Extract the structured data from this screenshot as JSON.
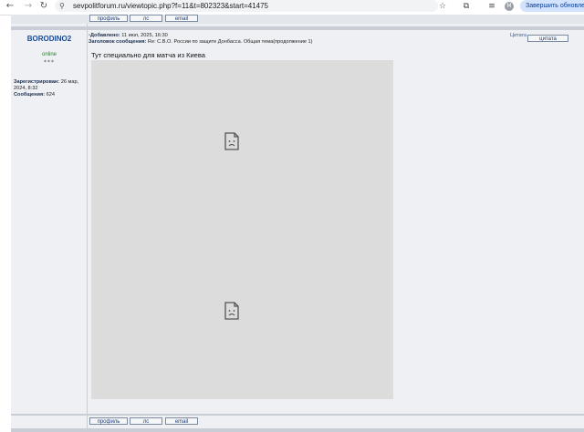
{
  "browser": {
    "back_glyph": "←",
    "forward_glyph": "→",
    "reload_glyph": "↻",
    "url": "sevpolitforum.ru/viewtopic.php?f=11&t=802323&start=41475",
    "profile_initial": "M",
    "finish_update_label": "Завершить обновление"
  },
  "post_buttons": {
    "profile": "профиль",
    "pm": "лс",
    "email": "email"
  },
  "author": {
    "username": "BORODINO2",
    "status": "online",
    "rank_stars": "***",
    "registered_label": "Зарегистрирован:",
    "registered_value": "26 мар, 2024, 8:32",
    "messages_label": "Сообщения:",
    "messages_value": "624"
  },
  "post": {
    "added_label": "Добавлено:",
    "added_value": "11 июл, 2025, 16:30",
    "subject_label": "Заголовок сообщения:",
    "subject_value": "Re: С.В.О. России по защите Донбасса. Общая тема(продолжение 1)",
    "quote_img_alt": "Цитата",
    "quote_button": "цитата",
    "text": "Тут специально для матча из Киева",
    "image_count": 2
  }
}
